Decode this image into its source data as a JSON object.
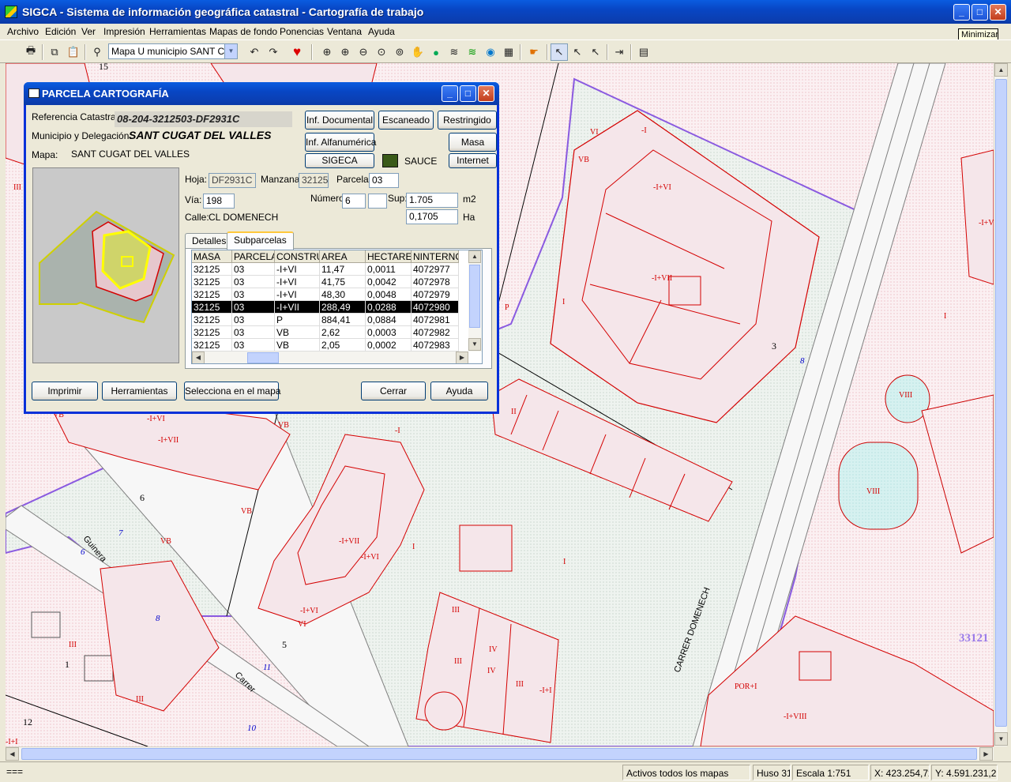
{
  "window": {
    "title": "SIGCA - Sistema de información geográfica catastral - Cartografía de trabajo",
    "caption_buttons": [
      "minimize-icon",
      "maximize-icon",
      "close-icon"
    ]
  },
  "menu": [
    "Archivo",
    "Edición",
    "Ver",
    "Impresión",
    "Herramientas",
    "Mapas de fondo",
    "Ponencias",
    "Ventana",
    "Ayuda"
  ],
  "tooltip": "Minimizar",
  "toolbar": {
    "map_select_value": "Mapa U municipio SANT CUGAT DEL VALLES"
  },
  "dialog": {
    "title": "PARCELA CARTOGRAFÍA",
    "ref_label": "Referencia Catastral:",
    "ref_value": "08-204-3212503-DF2931C",
    "municipio_label": "Municipio y Delegación:",
    "municipio_value": "SANT CUGAT DEL VALLES",
    "mapa_label": "Mapa:",
    "mapa_value": "SANT CUGAT DEL VALLES",
    "buttons": {
      "inf_documental": "Inf. Documental",
      "escaneado": "Escaneado",
      "restringido": "Restringido",
      "inf_alfanumerica": "Inf. Alfanumérica",
      "masa": "Masa",
      "sigeca": "SIGECA",
      "sauce": "SAUCE",
      "internet": "Internet",
      "imprimir": "Imprimir",
      "herramientas": "Herramientas",
      "selecciona": "Selecciona en el mapa",
      "cerrar": "Cerrar",
      "ayuda": "Ayuda"
    },
    "hoja_label": "Hoja:",
    "hoja_value": "DF2931C",
    "manzana_label": "Manzana:",
    "manzana_value": "32125",
    "parcela_label": "Parcela:",
    "parcela_value": "03",
    "via_label": "Vía:",
    "via_value": "198",
    "numero_label": "Número:",
    "numero_value": "6",
    "numero_extra": "",
    "sup_label": "Sup:",
    "sup_value": "1.705",
    "sup_unit": "m2",
    "ha_value": "0,1705",
    "ha_unit": "Ha",
    "calle_label": "Calle:",
    "calle_value": "CL DOMENECH",
    "tabs": [
      "Detalles",
      "Subparcelas"
    ],
    "grid_columns": [
      "MASA",
      "PARCELA",
      "CONSTRU",
      "AREA",
      "HECTAREA",
      "NINTERNO"
    ],
    "grid_rows": [
      [
        "32125",
        "03",
        "-I+VI",
        "11,47",
        "0,0011",
        "4072977"
      ],
      [
        "32125",
        "03",
        "-I+VI",
        "41,75",
        "0,0042",
        "4072978"
      ],
      [
        "32125",
        "03",
        "-I+VI",
        "48,30",
        "0,0048",
        "4072979"
      ],
      [
        "32125",
        "03",
        "-I+VII",
        "288,49",
        "0,0288",
        "4072980"
      ],
      [
        "32125",
        "03",
        "P",
        "884,41",
        "0,0884",
        "4072981"
      ],
      [
        "32125",
        "03",
        "VB",
        "2,62",
        "0,0003",
        "4072982"
      ],
      [
        "32125",
        "03",
        "VB",
        "2,05",
        "0,0002",
        "4072983"
      ]
    ],
    "selected_row": 3
  },
  "map_labels": {
    "parcel_numbers": [
      "15",
      "3",
      "6",
      "5",
      "1",
      "12"
    ],
    "block_number": "33121",
    "streets": [
      "CARRER DOMENECH",
      "Guinera",
      "Carrer"
    ],
    "street_numbers": [
      "7",
      "6",
      "8",
      "11",
      "10",
      "8"
    ],
    "construction_codes": [
      "-I",
      "-I+VI",
      "-I+VII",
      "VB",
      "VI",
      "P",
      "I",
      "II",
      "III",
      "IV",
      "PI",
      "POR",
      "VII",
      "VIII",
      "-I+I",
      "POR+I",
      "-I+VIII"
    ]
  },
  "status": {
    "left": "===",
    "mapas": "Activos todos los mapas",
    "huso": "Huso 31",
    "escala": "Escala 1:751",
    "x": "X: 423.254,72",
    "y": "Y: 4.591.231,29"
  },
  "colors": {
    "title_blue": "#0a46c6",
    "parcel_red": "#d40000",
    "block_purple": "#8a5ae0",
    "road_grey": "#7f7f7f",
    "pool_cyan": "#d4f1f0",
    "selected_yellow": "#ffff00"
  }
}
